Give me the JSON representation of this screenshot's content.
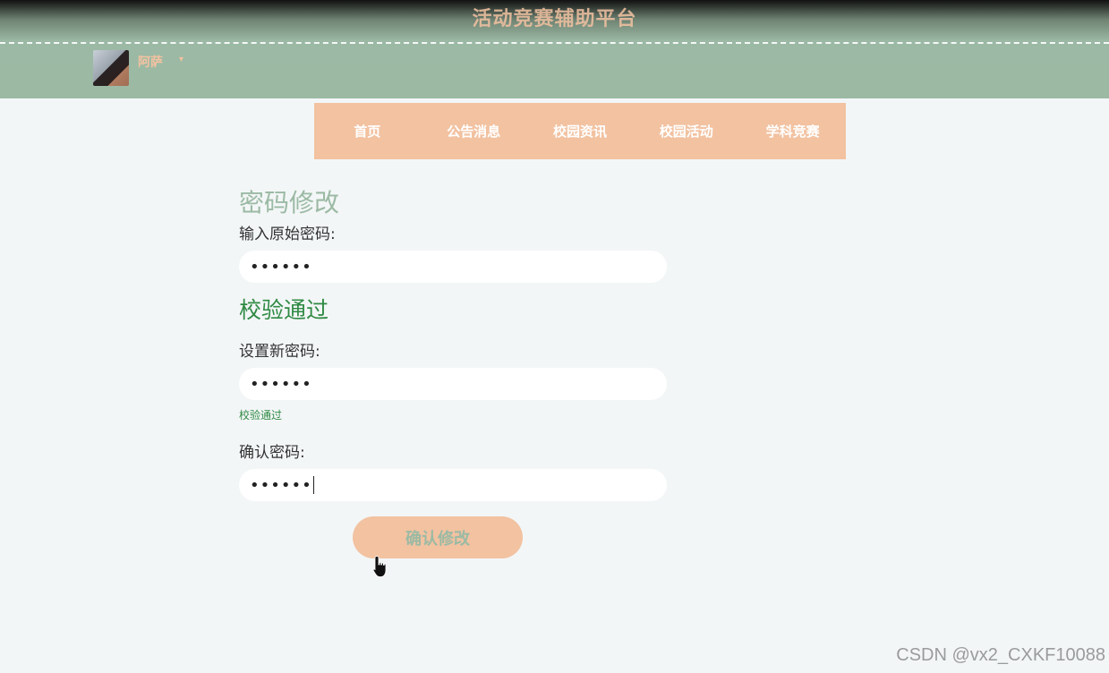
{
  "header": {
    "site_title": "活动竞赛辅助平台",
    "user": {
      "name": "阿萨",
      "caret": "▾"
    }
  },
  "nav": {
    "items": [
      {
        "label": "首页"
      },
      {
        "label": "公告消息"
      },
      {
        "label": "校园资讯"
      },
      {
        "label": "校园活动"
      },
      {
        "label": "学科竞赛"
      }
    ]
  },
  "form": {
    "title": "密码修改",
    "old_password": {
      "label": "输入原始密码:",
      "value": "••••••"
    },
    "old_status": "校验通过",
    "new_password": {
      "label": "设置新密码:",
      "value": "••••••"
    },
    "new_status": "校验通过",
    "confirm_password": {
      "label": "确认密码:",
      "value": "••••••"
    },
    "submit_label": "确认修改"
  },
  "watermark": "CSDN @vx2_CXKF10088",
  "colors": {
    "header_green": "#9cb9a4",
    "accent_peach": "#f2c2a1",
    "success_green": "#2f8a43",
    "background": "#f3f6f7"
  }
}
